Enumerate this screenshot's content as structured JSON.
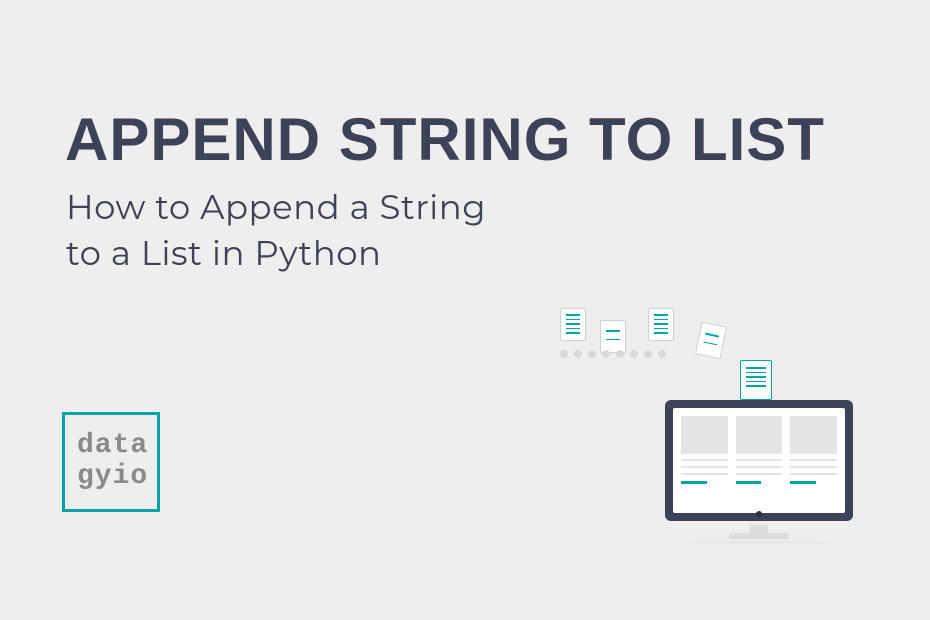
{
  "title": "APPEND STRING TO LIST",
  "subtitle_line1": "How to Append a String",
  "subtitle_line2": "to a List in Python",
  "logo": {
    "line1": "data",
    "line2": "gyio"
  }
}
